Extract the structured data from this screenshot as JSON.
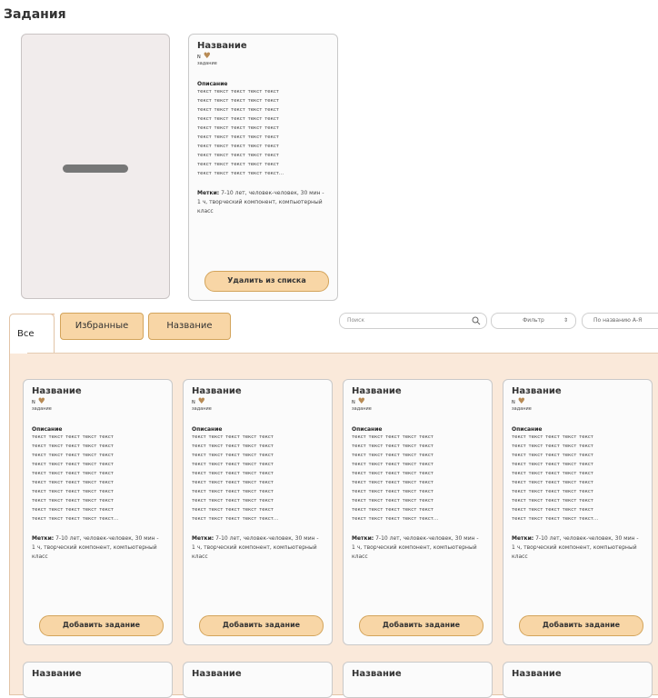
{
  "page": {
    "title": "Задания"
  },
  "selected": {
    "title": "Название",
    "n": "N",
    "task_word": "задание",
    "desc_heading": "Описание",
    "desc_lines": [
      "текст текст текст текст текст",
      "текст текст текст текст текст",
      "текст текст текст текст текст",
      "текст текст текст текст текст",
      "текст текст текст текст текст",
      "текст текст текст текст текст",
      "текст текст текст текст текст",
      "текст текст текст текст текст",
      "текст текст текст текст текст",
      "текст текст текст текст текст..."
    ],
    "tags_label": "Метки:",
    "tags_text": " 7-10 лет, человек-человек, 30 мин - 1 ч, творческий компонент, компьютерный класс",
    "button": "Удалить из списка"
  },
  "tabs": {
    "all": "Все",
    "favorites": "Избранные",
    "name": "Название"
  },
  "toolbar": {
    "search_placeholder": "Поиск",
    "filter": "Фильтр",
    "sort": "По названию А-Я"
  },
  "cards": [
    {
      "title": "Название",
      "n": "N",
      "task_word": "задание",
      "desc_heading": "Описание",
      "tags_label": "Метки:",
      "tags_text": " 7-10 лет, человек-человек, 30 мин - 1 ч, творческий компонент, компьютерный класс",
      "button": "Добавить задание"
    },
    {
      "title": "Название",
      "n": "N",
      "task_word": "задание",
      "desc_heading": "Описание",
      "tags_label": "Метки:",
      "tags_text": " 7-10 лет, человек-человек, 30 мин - 1 ч, творческий компонент, компьютерный класс",
      "button": "Добавить задание"
    },
    {
      "title": "Название",
      "n": "N",
      "task_word": "задание",
      "desc_heading": "Описание",
      "tags_label": "Метки:",
      "tags_text": " 7-10 лет, человек-человек, 30 мин - 1 ч, творческий компонент, компьютерный класс",
      "button": "Добавить задание"
    },
    {
      "title": "Название",
      "n": "N",
      "task_word": "задание",
      "desc_heading": "Описание",
      "tags_label": "Метки:",
      "tags_text": " 7-10 лет, человек-человек, 30 мин - 1 ч, творческий компонент, компьютерный класс",
      "button": "Добавить задание"
    }
  ],
  "desc_lines": [
    "текст текст текст текст текст",
    "текст текст текст текст текст",
    "текст текст текст текст текст",
    "текст текст текст текст текст",
    "текст текст текст текст текст",
    "текст текст текст текст текст",
    "текст текст текст текст текст",
    "текст текст текст текст текст",
    "текст текст текст текст текст",
    "текст текст текст текст текст..."
  ],
  "row2_titles": [
    "Название",
    "Название",
    "Название",
    "Название"
  ],
  "icons": {
    "favorite": "heart-icon",
    "search": "search-icon",
    "select": "chevron-up-down-icon"
  },
  "colors": {
    "accent": "#f8d6a6",
    "accent_border": "#d3a45b",
    "panel_bg": "#fae9da",
    "heart": "#b88b55"
  }
}
